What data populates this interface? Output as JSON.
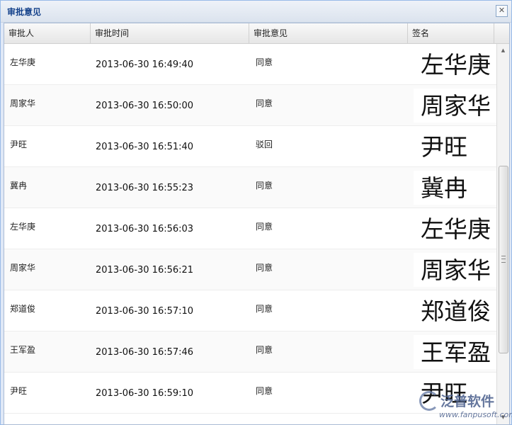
{
  "dialog": {
    "title": "审批意见",
    "close_glyph": "✕"
  },
  "columns": [
    "审批人",
    "审批时间",
    "审批意见",
    "签名"
  ],
  "rows": [
    {
      "approver": "左华庚",
      "time": "2013-06-30 16:49:40",
      "opinion": "同意",
      "signature": "左华庚"
    },
    {
      "approver": "周家华",
      "time": "2013-06-30 16:50:00",
      "opinion": "同意",
      "signature": "周家华"
    },
    {
      "approver": "尹旺",
      "time": "2013-06-30 16:51:40",
      "opinion": "驳回",
      "signature": "尹旺"
    },
    {
      "approver": "冀冉",
      "time": "2013-06-30 16:55:23",
      "opinion": "同意",
      "signature": "冀冉"
    },
    {
      "approver": "左华庚",
      "time": "2013-06-30 16:56:03",
      "opinion": "同意",
      "signature": "左华庚"
    },
    {
      "approver": "周家华",
      "time": "2013-06-30 16:56:21",
      "opinion": "同意",
      "signature": "周家华"
    },
    {
      "approver": "郑道俊",
      "time": "2013-06-30 16:57:10",
      "opinion": "同意",
      "signature": "郑道俊"
    },
    {
      "approver": "王军盈",
      "time": "2013-06-30 16:57:46",
      "opinion": "同意",
      "signature": "王军盈"
    },
    {
      "approver": "尹旺",
      "time": "2013-06-30 16:59:10",
      "opinion": "同意",
      "signature": "尹旺"
    }
  ],
  "scrollbar": {
    "up_glyph": "▲",
    "down_glyph": "▼"
  },
  "watermark": {
    "text": "泛普软件",
    "url": "www.fanpusoft.com"
  },
  "colors": {
    "title": "#15428b",
    "border": "#99bbe8",
    "watermark": "#4a5f8c"
  }
}
